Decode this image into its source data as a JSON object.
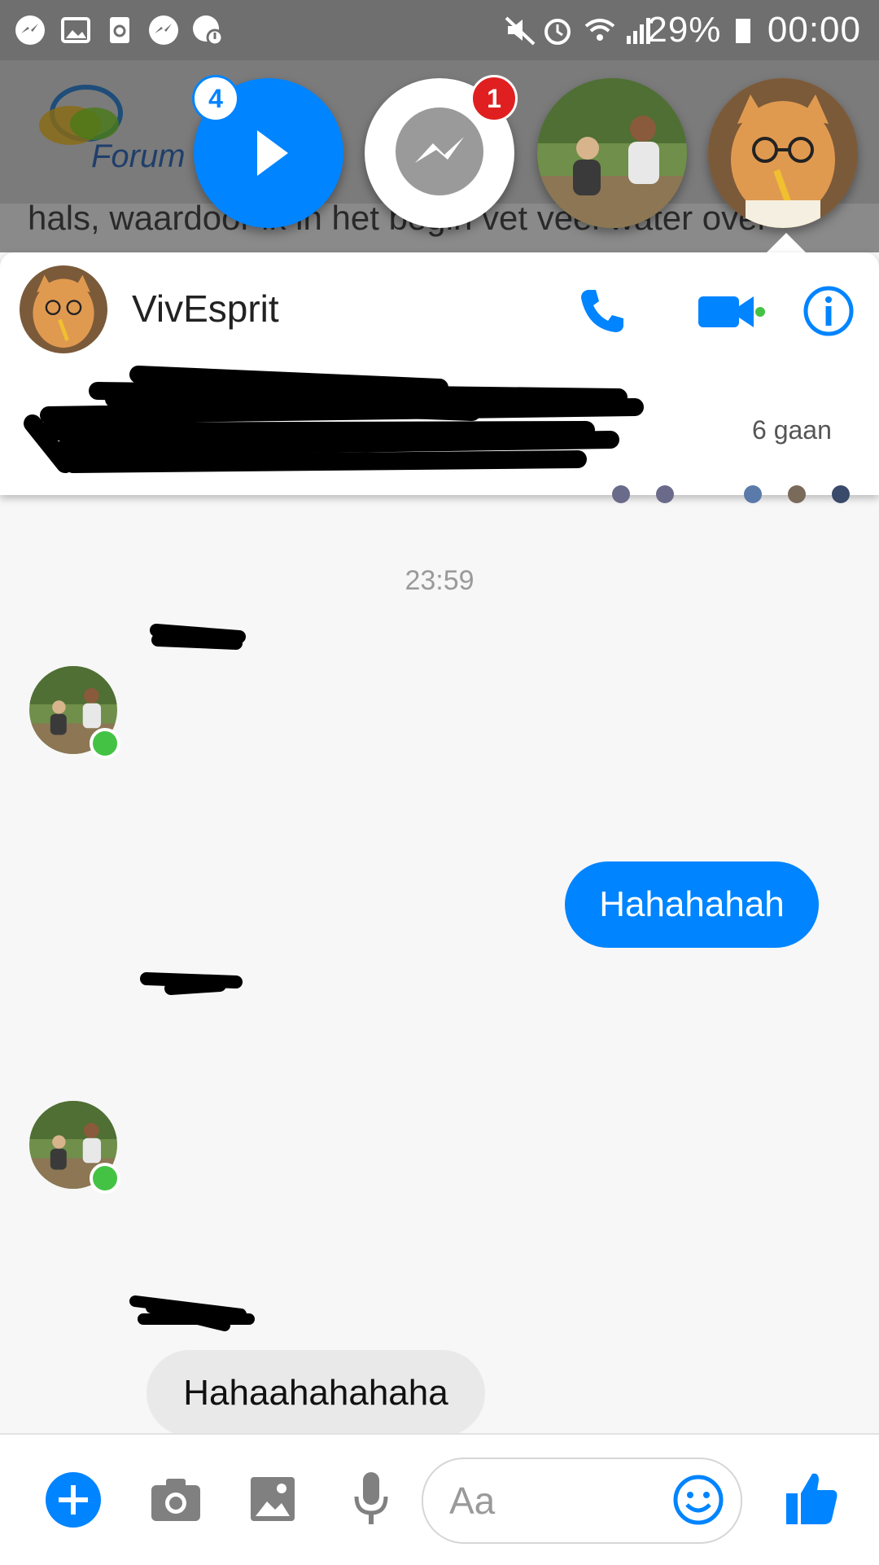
{
  "status_bar": {
    "battery": "29%",
    "time": "00:00"
  },
  "background": {
    "logo_text": "Forum I",
    "text_line": "hals, waardoor ik in het begin vet veel water over"
  },
  "chat_heads": [
    {
      "name": "play-head",
      "badge": "4"
    },
    {
      "name": "messenger-head",
      "badge": "1"
    },
    {
      "name": "family-head"
    },
    {
      "name": "cat-head"
    }
  ],
  "conversation": {
    "contact_name": "VivEsprit",
    "time_ago": "6 gaan",
    "timestamp": "23:59",
    "messages": [
      {
        "direction": "out",
        "text": "Hahahahah"
      },
      {
        "direction": "in",
        "text": "Hahaahahahaha"
      }
    ]
  },
  "composer": {
    "placeholder": "Aa"
  },
  "colors": {
    "accent": "#0084ff",
    "online": "#44c244",
    "badge_red": "#e02020"
  }
}
